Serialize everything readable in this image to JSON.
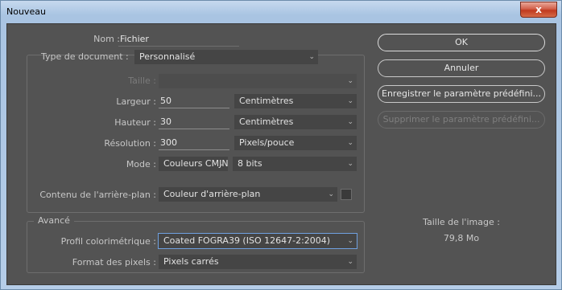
{
  "window": {
    "title": "Nouveau",
    "close_glyph": "x"
  },
  "form": {
    "name_label": "Nom :",
    "name_value": "Fichier",
    "doc_type_label": "Type de document :",
    "doc_type_value": "Personnalisé",
    "size_label": "Taille :",
    "size_value": "",
    "width_label": "Largeur :",
    "width_value": "50",
    "width_unit": "Centimètres",
    "height_label": "Hauteur :",
    "height_value": "30",
    "height_unit": "Centimètres",
    "resolution_label": "Résolution :",
    "resolution_value": "300",
    "resolution_unit": "Pixels/pouce",
    "mode_label": "Mode :",
    "mode_value": "Couleurs CMJN",
    "bits_value": "8 bits",
    "background_label": "Contenu de l'arrière-plan :",
    "background_value": "Couleur d'arrière-plan"
  },
  "advanced": {
    "title": "Avancé",
    "profile_label": "Profil colorimétrique :",
    "profile_value": "Coated FOGRA39 (ISO 12647-2:2004)",
    "pixel_format_label": "Format des pixels :",
    "pixel_format_value": "Pixels carrés"
  },
  "buttons": {
    "ok": "OK",
    "cancel": "Annuler",
    "save_preset": "Enregistrer le paramètre prédéfini...",
    "delete_preset": "Supprimer le paramètre prédéfini..."
  },
  "image_size": {
    "label": "Taille de l'image :",
    "value": "79,8 Mo"
  },
  "colors": {
    "panel": "#535353",
    "field": "#454545",
    "titlebar": "#b5cde8",
    "close": "#c0391f"
  },
  "icons": {
    "dropdown": "chevron-down-icon",
    "close": "close-icon"
  }
}
